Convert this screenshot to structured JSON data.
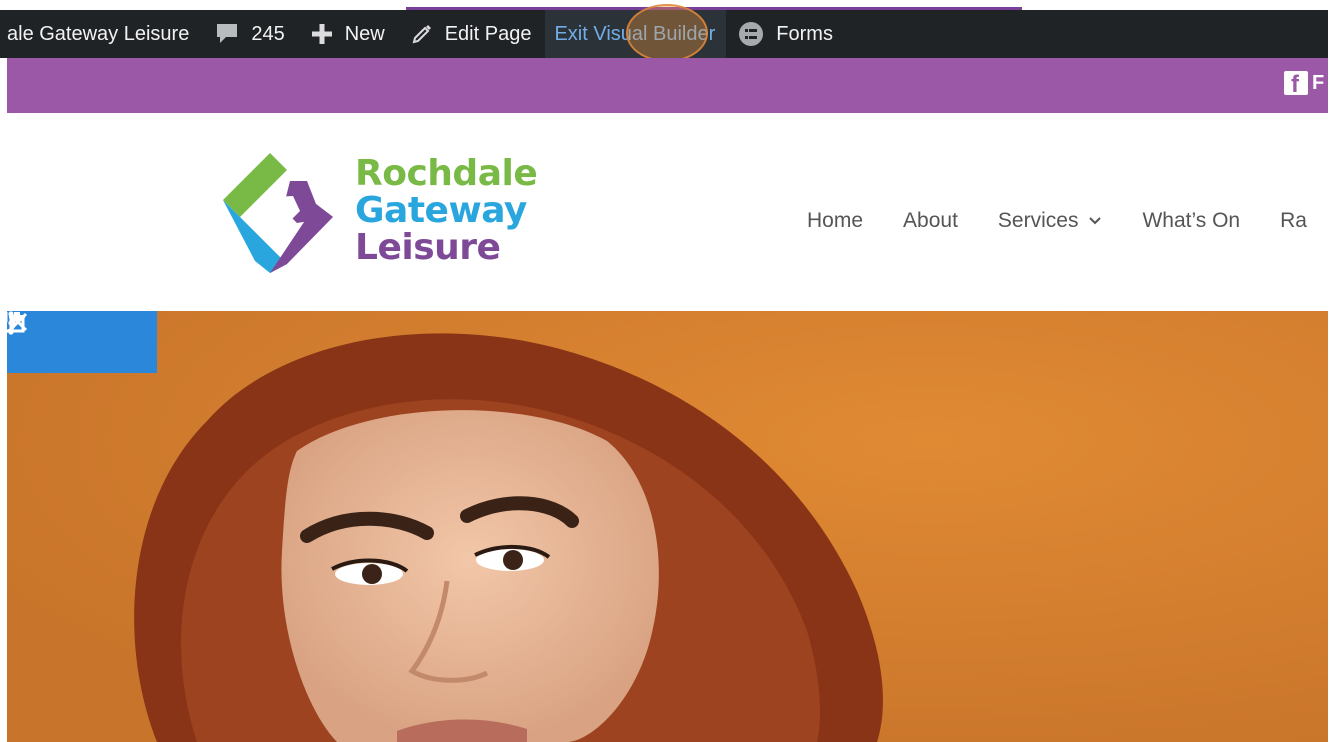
{
  "admin_bar": {
    "site_name": "ale Gateway Leisure",
    "comments_count": "245",
    "new_label": "New",
    "edit_page_label": "Edit Page",
    "exit_builder_label": "Exit Visual Builder",
    "forms_label": "Forms"
  },
  "top_bar": {
    "facebook_text": "F"
  },
  "logo": {
    "line1": "Rochdale",
    "line2": "Gateway",
    "line3": "Leisure"
  },
  "nav": {
    "items": [
      {
        "label": "Home"
      },
      {
        "label": "About"
      },
      {
        "label": "Services",
        "has_dropdown": true
      },
      {
        "label": "What’s On"
      },
      {
        "label": "Ra"
      }
    ]
  },
  "builder_toolbar": {
    "buttons": [
      "power-icon",
      "trash-icon",
      "close-icon",
      "more-vertical-icon"
    ]
  },
  "colors": {
    "admin_bar_bg": "#1f2326",
    "exit_builder_text": "#72aee6",
    "top_bar_purple": "#9b58a6",
    "logo_green": "#79b945",
    "logo_blue": "#2aa6df",
    "logo_purple": "#7e4a98",
    "builder_blue": "#2b87da",
    "hero_orange": "#d98230"
  }
}
